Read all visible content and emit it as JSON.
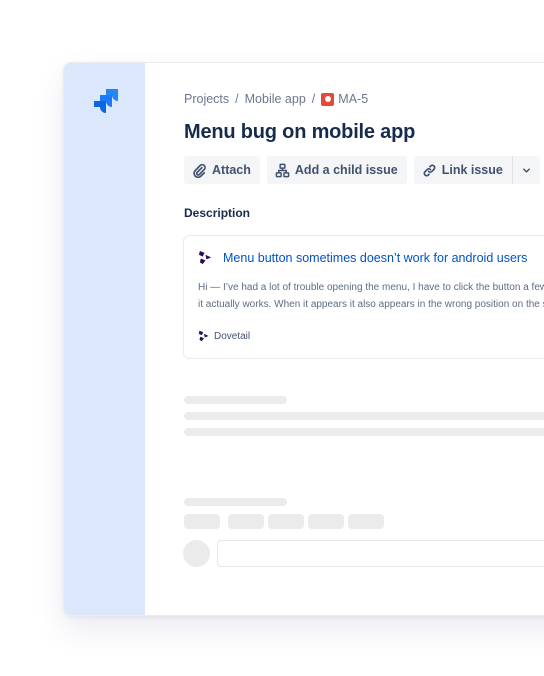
{
  "app": {
    "name": "Jira"
  },
  "breadcrumb": {
    "items": [
      "Projects",
      "Mobile app"
    ],
    "separator": "/",
    "issue_key": "MA-5",
    "issue_type_color": "#e5493a"
  },
  "issue": {
    "title": "Menu bug on mobile app"
  },
  "toolbar": {
    "attach_label": "Attach",
    "add_child_label": "Add a child issue",
    "link_issue_label": "Link issue",
    "more_label": "•••"
  },
  "description": {
    "label": "Description",
    "card": {
      "title": "Menu button sometimes doesn’t work for android users",
      "body_line_1": "Hi — I’ve had a lot of trouble opening the menu, I have to click the button a few times before",
      "body_line_2": "it actually works. When it appears it also appears in the wrong position on the screen.",
      "source": "Dovetail"
    }
  },
  "colors": {
    "sidebar_bg": "#dbe8fb",
    "brand_blue": "#2684ff",
    "link": "#0052cc",
    "dovetail": "#2a0c5a",
    "skeleton": "#ebebeb"
  }
}
